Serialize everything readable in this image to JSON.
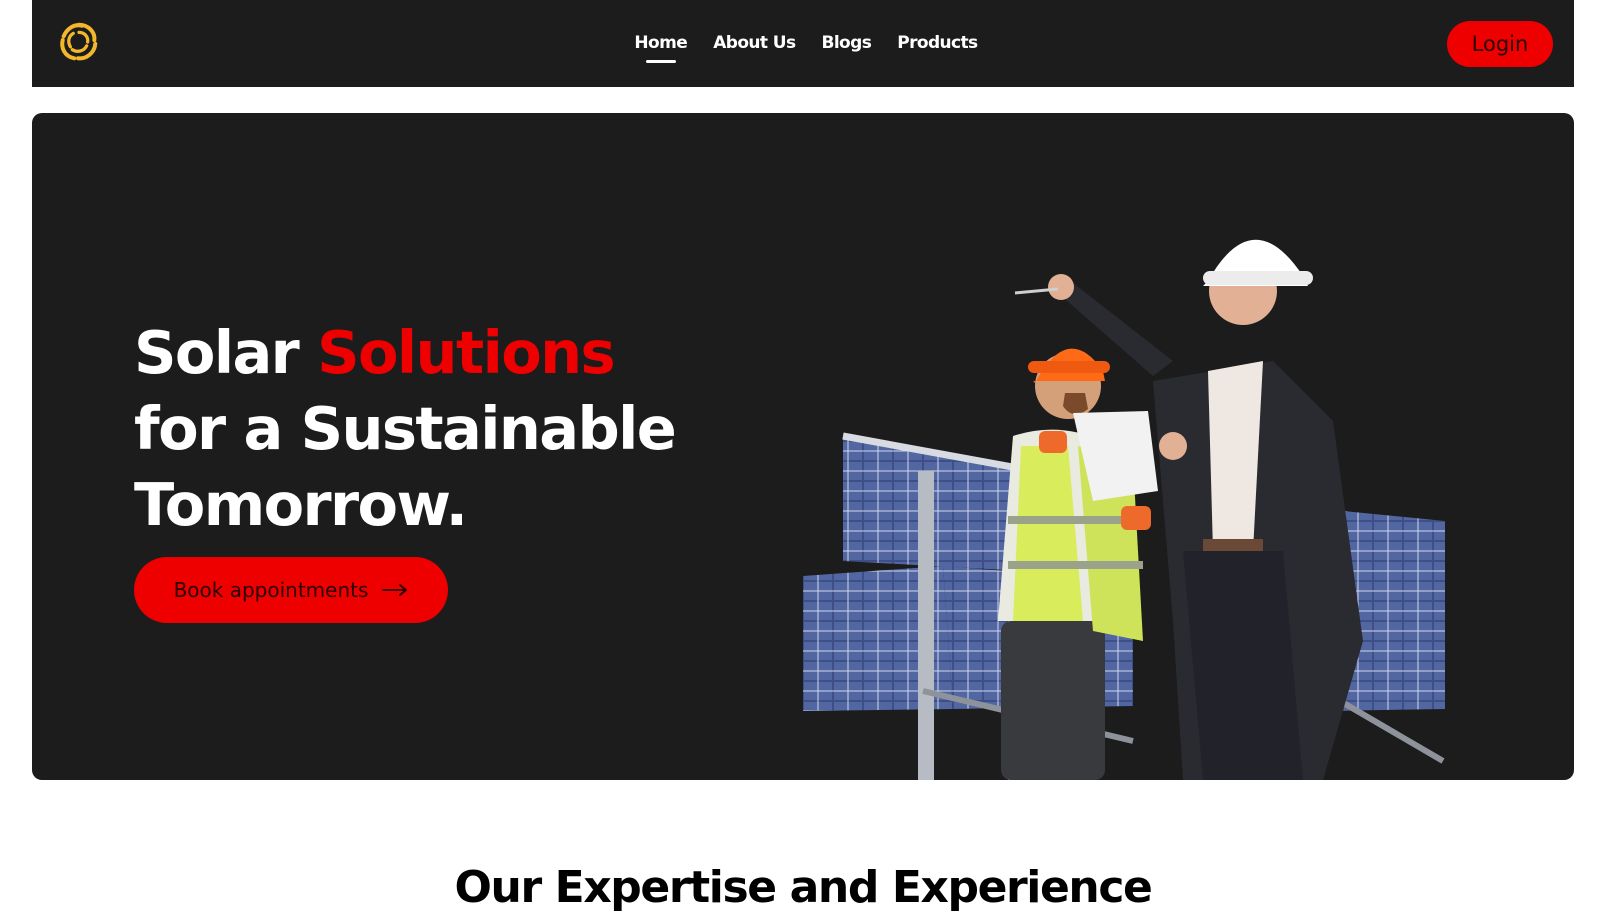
{
  "navbar": {
    "logo_icon": "sun-swirl-logo-icon",
    "links": [
      {
        "label": "Home",
        "active": true
      },
      {
        "label": "About Us",
        "active": false
      },
      {
        "label": "Blogs",
        "active": false
      },
      {
        "label": "Products",
        "active": false
      }
    ],
    "login_label": "Login"
  },
  "hero": {
    "headline_part1": "Solar ",
    "headline_accent": "Solutions",
    "headline_line2": "for a Sustainable",
    "headline_line3": "Tomorrow.",
    "cta_label": "Book appointments",
    "cta_icon": "arrow-right-icon",
    "image": "engineers-inspecting-solar-panels-photo"
  },
  "section": {
    "title": "Our Expertise and Experience"
  },
  "colors": {
    "accent": "#ee0000",
    "dark": "#1c1c1c",
    "logo": "#f2b82c"
  }
}
